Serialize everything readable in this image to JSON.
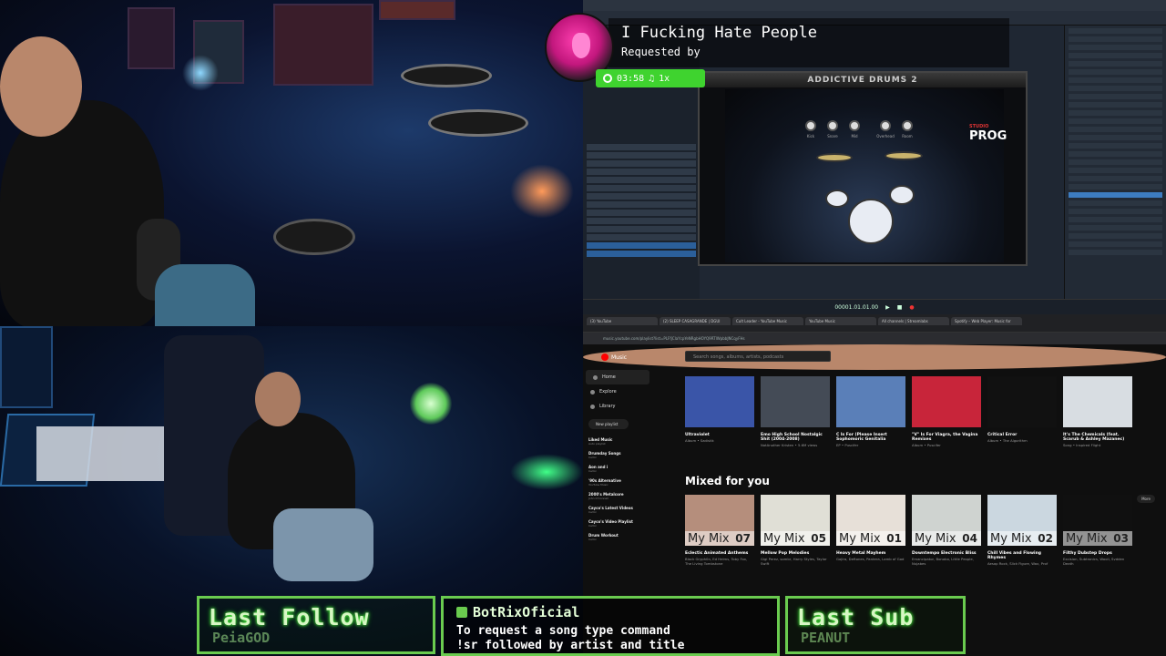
{
  "now_playing": {
    "title": "I Fucking Hate People",
    "requested_by_label": "Requested by",
    "elapsed": "03:58",
    "speed": "1x"
  },
  "daw": {
    "plugin_brand": "ADDICTIVE DRUMS 2",
    "kit_name": "PROG",
    "kit_prefix": "STUDIO",
    "transport_time": "00001.01.01.00",
    "knobs": [
      "Kick",
      "Snare",
      "Mid",
      "Overhead",
      "Room"
    ]
  },
  "youtube": {
    "tabs": [
      "(3) YouTube",
      "(2) SLEEP CASAGRANDE | DGUI",
      "Cult Leader - YouTube Music",
      "YouTube Music",
      "All channels | Streamlabs",
      "Spotify – Web Player: Music for"
    ],
    "url": "music.youtube.com/playlist?list=PLFfjClaYcpYeNRgbHOYQ9RTlWpbbJNCqyFHs",
    "logo": "Music",
    "search_placeholder": "Search songs, albums, artists, podcasts",
    "nav": [
      {
        "label": "Home"
      },
      {
        "label": "Explore"
      },
      {
        "label": "Library"
      }
    ],
    "new_playlist": "New playlist",
    "playlists": [
      {
        "name": "Liked Music",
        "sub": "Auto playlist"
      },
      {
        "name": "Drumday Songs",
        "sub": "CeVol"
      },
      {
        "name": "Aon and i",
        "sub": "CeVol"
      },
      {
        "name": "'90s Alternative",
        "sub": "YouTube Music"
      },
      {
        "name": "2000's Metalcore",
        "sub": "John O'Connell"
      },
      {
        "name": "Cayco's Latest Videos",
        "sub": "CeVol"
      },
      {
        "name": "Cayco's Video Playlist",
        "sub": "CeVol"
      },
      {
        "name": "Drum Workout",
        "sub": "CeVol"
      }
    ],
    "top_row": [
      {
        "title": "Ultraviolet",
        "sub": "Album • Sadistik",
        "color": "#3a55a8"
      },
      {
        "title": "Emo High School Nostalgic Shit (2004-2008)",
        "sub": "NotAnother Kristen • 5.6M views",
        "color": "#444b56"
      },
      {
        "title": "C Is For (Please Insert Sophomoric Genitalia",
        "sub": "EP • Puscifer",
        "color": "#5a7fb8"
      },
      {
        "title": "\"V\" Is For Viagra, the Vagina Remixes",
        "sub": "Album • Puscifer",
        "color": "#c8253a"
      },
      {
        "title": "Critical Error",
        "sub": "Album • The Algorithm",
        "color": "#111111"
      },
      {
        "title": "It's The Chemicals (feat. Scarub & Ashley Mazanec)",
        "sub": "Song • Inspired Flight",
        "color": "#d8dde2"
      }
    ],
    "section_title": "Mixed for you",
    "more_label": "More",
    "my_mix_label": "My Mix",
    "mixes": [
      {
        "num": "07",
        "title": "Eclectic Animated Anthems",
        "sub": "Black Gryph0n, Ed Helms, Toby Fox, The Living Tombstone",
        "color": "#b58e7c"
      },
      {
        "num": "05",
        "title": "Mellow Pop Melodies",
        "sub": "Gigi Perez, sombr, Harry Styles, Taylor Swift",
        "color": "#e0dfd6"
      },
      {
        "num": "01",
        "title": "Heavy Metal Mayhem",
        "sub": "Gojira, Deftones, Pantera, Lamb of God",
        "color": "#e7e0d8"
      },
      {
        "num": "04",
        "title": "Downtempo Electronic Bliss",
        "sub": "Emancipator, Bonobo, Little People, Nujabes",
        "color": "#cfd3d0"
      },
      {
        "num": "02",
        "title": "Chill Vibes and Flowing Rhymes",
        "sub": "Aesop Rock, Slick Figure, Wax, Prof",
        "color": "#cbd7e0"
      },
      {
        "num": "03",
        "title": "Filthy Dubstep Drops",
        "sub": "Excision, Subtronics, Wooli, Svdden Death",
        "color": "#101010"
      }
    ]
  },
  "overlay": {
    "last_follow_label": "Last Follow",
    "last_follow_name": "PeiaGOD",
    "last_sub_label": "Last Sub",
    "last_sub_name": "PEANUT",
    "bot_name": "BotRixOficial",
    "bot_line1": "To request a song type command",
    "bot_line2": "!sr followed by artist and title",
    "accent": "#6acb4f"
  }
}
